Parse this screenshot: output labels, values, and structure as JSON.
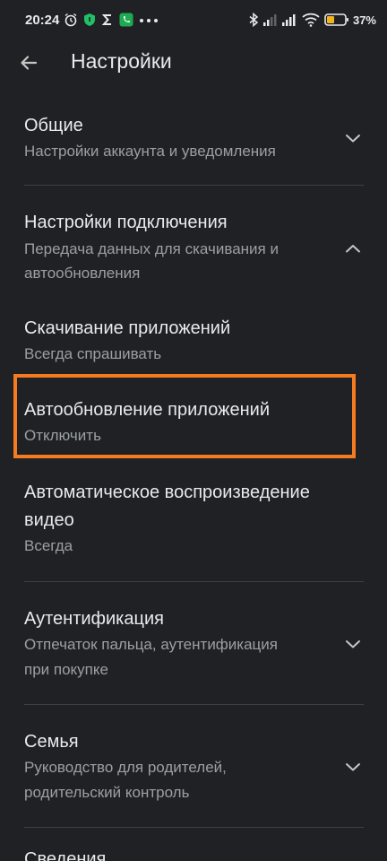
{
  "status_bar": {
    "time": "20:24",
    "battery": "37%",
    "icons": [
      "alarm-icon",
      "shield-icon",
      "sigma-icon",
      "phone-app-icon",
      "more-dots-icon",
      "bluetooth-icon",
      "signal-icon",
      "signal-icon",
      "wifi-icon",
      "battery-icon"
    ]
  },
  "header": {
    "title": "Настройки",
    "back_icon": "arrow-back-icon"
  },
  "colors": {
    "background": "#202124",
    "text_primary": "#e8eaed",
    "text_secondary": "#9aa0a6",
    "divider": "#3c4043",
    "highlight": "#f47b20"
  },
  "settings": {
    "general": {
      "title": "Общие",
      "subtitle": "Настройки аккаунта и уведомления",
      "chevron": "chevron-down-icon"
    },
    "connection": {
      "title": "Настройки подключения",
      "subtitle_line1": "Передача данных для скачивания и",
      "subtitle_line2": "автообновления",
      "chevron": "chevron-up-icon"
    },
    "download": {
      "title": "Скачивание приложений",
      "subtitle": "Всегда спрашивать"
    },
    "autoupdate": {
      "title": "Автообновление приложений",
      "subtitle": "Отключить"
    },
    "autoplay": {
      "title_line1": "Автоматическое воспроизведение",
      "title_line2": "видео",
      "subtitle": "Всегда"
    },
    "auth": {
      "title": "Аутентификация",
      "subtitle_line1": "Отпечаток пальца, аутентификация",
      "subtitle_line2": "при покупке",
      "chevron": "chevron-down-icon"
    },
    "family": {
      "title": "Семья",
      "subtitle_line1": "Руководство для родителей,",
      "subtitle_line2": "родительский контроль",
      "chevron": "chevron-down-icon"
    },
    "about": {
      "title": "Сведения"
    }
  }
}
